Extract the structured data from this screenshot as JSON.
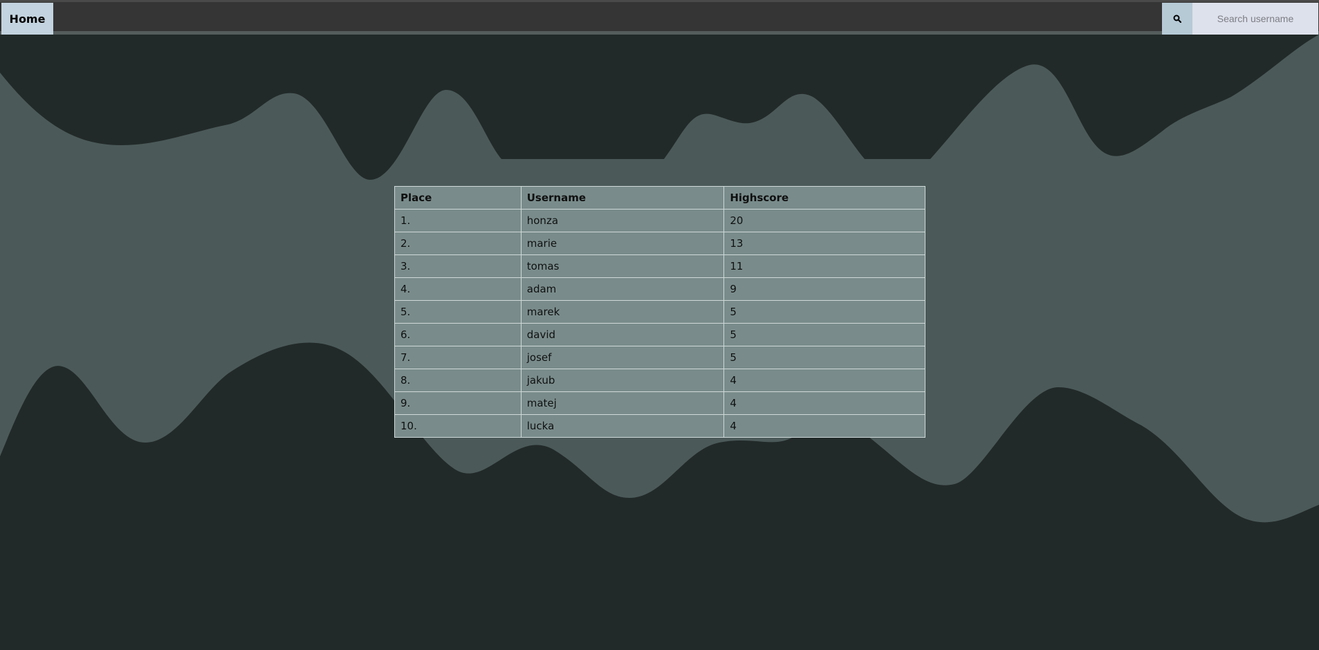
{
  "nav": {
    "home_label": "Home",
    "search_icon": "search-icon",
    "search_placeholder": "Search username"
  },
  "colors": {
    "navbar": "#353535",
    "home_button": "#c3d3df",
    "search_button": "#b6cad6",
    "search_input": "#dde1eb",
    "background_dark": "#222a29",
    "background_wave": "#4b5a59",
    "table_fill": "#798c8b",
    "table_border": "#cfd8d8"
  },
  "leaderboard": {
    "headers": [
      "Place",
      "Username",
      "Highscore"
    ],
    "rows": [
      {
        "place": "1.",
        "username": "honza",
        "score": "20"
      },
      {
        "place": "2.",
        "username": "marie",
        "score": "13"
      },
      {
        "place": "3.",
        "username": "tomas",
        "score": "11"
      },
      {
        "place": "4.",
        "username": "adam",
        "score": "9"
      },
      {
        "place": "5.",
        "username": "marek",
        "score": "5"
      },
      {
        "place": "6.",
        "username": "david",
        "score": "5"
      },
      {
        "place": "7.",
        "username": "josef",
        "score": "5"
      },
      {
        "place": "8.",
        "username": "jakub",
        "score": "4"
      },
      {
        "place": "9.",
        "username": "matej",
        "score": "4"
      },
      {
        "place": "10.",
        "username": "lucka",
        "score": "4"
      }
    ]
  }
}
